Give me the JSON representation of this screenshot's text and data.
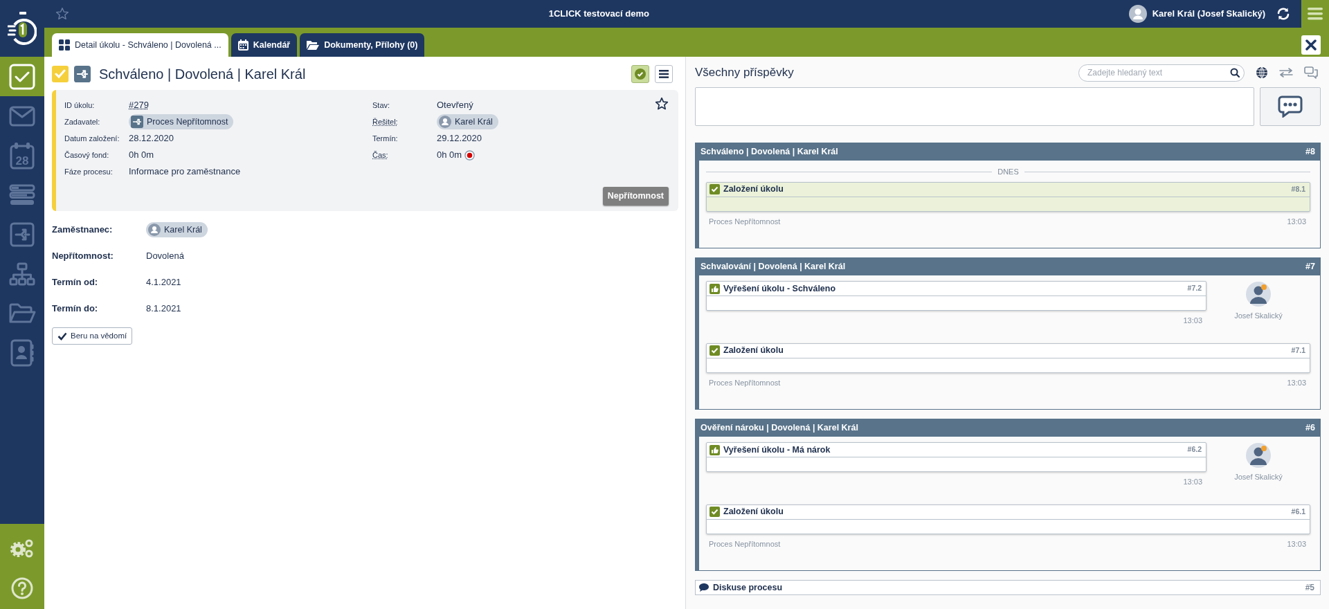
{
  "app": {
    "title": "1CLICK testovací demo",
    "user": "Karel Král (Josef Skalický)"
  },
  "sidebar": {
    "items": [
      {
        "kind": "tasks",
        "selected": true
      },
      {
        "kind": "mail",
        "selected": false
      },
      {
        "kind": "calendar",
        "day": "28",
        "selected": false
      },
      {
        "kind": "list",
        "selected": false
      },
      {
        "kind": "process",
        "selected": false
      },
      {
        "kind": "org",
        "selected": false
      },
      {
        "kind": "folder",
        "selected": false
      },
      {
        "kind": "contacts",
        "selected": false
      }
    ],
    "bottom": [
      {
        "kind": "settings"
      },
      {
        "kind": "help"
      }
    ]
  },
  "tabs": [
    {
      "kind": "detail",
      "label": "Detail úkolu - Schváleno | Dovolená ...",
      "selected": true
    },
    {
      "kind": "calendar",
      "label": "Kalendář",
      "selected": false
    },
    {
      "kind": "folder",
      "label": "Dokumenty, Přílohy (0)",
      "selected": false
    }
  ],
  "task": {
    "title": "Schváleno | Dovolená | Karel Král",
    "fields_left": [
      {
        "label": "ID úkolu:",
        "value": "#279",
        "kind": "link",
        "tooltip": false
      },
      {
        "label": "Zadavatel:",
        "value": "Proces Nepřítomnost",
        "kind": "process-chip",
        "tooltip": false
      },
      {
        "label": "Datum založení:",
        "value": "28.12.2020",
        "kind": "text",
        "tooltip": false
      },
      {
        "label": "Časový fond:",
        "value": "0h 0m",
        "kind": "text",
        "tooltip": false
      },
      {
        "label": "Fáze procesu:",
        "value": "Informace pro zaměstnance",
        "kind": "text",
        "tooltip": false
      }
    ],
    "fields_right": [
      {
        "label": "Stav:",
        "value": "Otevřený",
        "kind": "text",
        "tooltip": false
      },
      {
        "label": "Řešitel:",
        "value": "Karel Král",
        "kind": "person-chip",
        "tooltip": true
      },
      {
        "label": "Termín:",
        "value": "29.12.2020",
        "kind": "text",
        "tooltip": false
      },
      {
        "label": "Čas:",
        "value": "0h 0m",
        "kind": "timer",
        "tooltip": true
      }
    ],
    "phase_button": "Nepřítomnost",
    "details": [
      {
        "label": "Zaměstnanec:",
        "value": "Karel Král",
        "kind": "person-chip"
      },
      {
        "label": "Nepřítomnost:",
        "value": "Dovolená",
        "kind": "text"
      },
      {
        "label": "Termín od:",
        "value": "4.1.2021",
        "kind": "text"
      },
      {
        "label": "Termín do:",
        "value": "8.1.2021",
        "kind": "text"
      }
    ],
    "acknowledge_button": "Beru na vědomí"
  },
  "feed": {
    "title": "Všechny příspěvky",
    "search": {
      "placeholder": "Zadejte hledaný text"
    },
    "groups": [
      {
        "kind": "process",
        "title": "Schváleno | Dovolená | Karel Král",
        "number": "#8",
        "date_divider": "DNES",
        "entries": [
          {
            "kind": "created",
            "title": "Založení úkolu",
            "number": "#8.1",
            "highlighted": true,
            "source": "Proces Nepřítomnost",
            "time": "13:03"
          }
        ]
      },
      {
        "kind": "process",
        "title": "Schvalování | Dovolená | Karel Král",
        "number": "#7",
        "entries": [
          {
            "kind": "resolved",
            "title": "Vyřešení úkolu - Schváleno",
            "number": "#7.2",
            "highlighted": false,
            "time": "13:03",
            "author": "Josef Skalický"
          },
          {
            "kind": "created",
            "title": "Založení úkolu",
            "number": "#7.1",
            "highlighted": false,
            "source": "Proces Nepřítomnost",
            "time": "13:03"
          }
        ]
      },
      {
        "kind": "process",
        "title": "Ověření nároku | Dovolená | Karel Král",
        "number": "#6",
        "entries": [
          {
            "kind": "resolved",
            "title": "Vyřešení úkolu - Má nárok",
            "number": "#6.2",
            "highlighted": false,
            "time": "13:03",
            "author": "Josef Skalický"
          },
          {
            "kind": "created",
            "title": "Založení úkolu",
            "number": "#6.1",
            "highlighted": false,
            "source": "Proces Nepřítomnost",
            "time": "13:03"
          }
        ]
      },
      {
        "kind": "discussion",
        "title": "Diskuse procesu",
        "number": "#5"
      }
    ]
  }
}
